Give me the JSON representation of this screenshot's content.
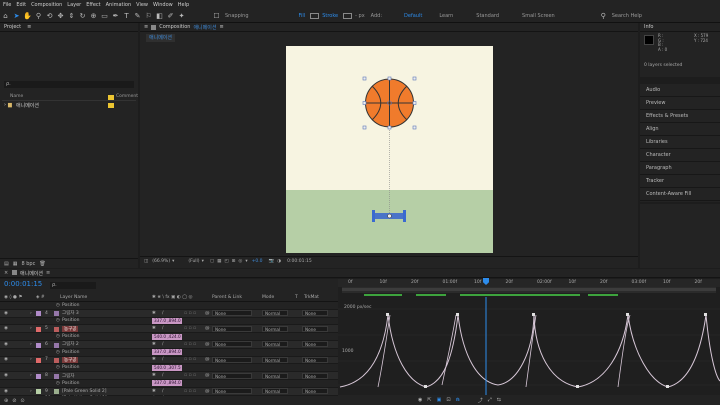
{
  "menu": [
    "File",
    "Edit",
    "Composition",
    "Layer",
    "Effect",
    "Animation",
    "View",
    "Window",
    "Help"
  ],
  "toolbar": {
    "snapping": "Snapping",
    "fill": "Fill",
    "stroke": "Stroke",
    "px": "- px",
    "add": "Add:",
    "workspaces": [
      "Default",
      "Learn",
      "Standard",
      "Small Screen"
    ],
    "search": "Search Help",
    "accent": "#2d8ceb"
  },
  "project": {
    "title": "Project",
    "search_placeholder": "ρ.",
    "col_name": "Name",
    "col_comment": "Comment",
    "item": "애니메이션"
  },
  "project_footer": {
    "bpc": "8 bpc"
  },
  "composition": {
    "header": "Composition",
    "comp_name": "애니메이션",
    "tab": "애니메이션",
    "footer": {
      "zoom": "(66.9%)",
      "res": "(Full)",
      "time": "0:00:01:15",
      "exposure": "+0.0"
    },
    "bg_top": "#f7f4e1",
    "bg_bottom": "#b6cfa6"
  },
  "info": {
    "title": "Info",
    "r": "R :",
    "g": "G :",
    "b": "B :",
    "a": "A : 0",
    "x": "X : 579",
    "y": "Y : 724",
    "selected": "0 layers selected"
  },
  "right_panels": [
    "Audio",
    "Preview",
    "Effects & Presets",
    "Align",
    "Libraries",
    "Character",
    "Paragraph",
    "Tracker",
    "Content-Aware Fill"
  ],
  "timeline": {
    "tab": "애니메이션",
    "timecode": "0:00:01:15",
    "search_placeholder": "ρ.",
    "headers": {
      "layer_name": "Layer Name",
      "parent": "Parent & Link",
      "mode": "Mode",
      "t": "T",
      "trkmat": "TrkMat"
    },
    "rows": [
      {
        "type": "prop",
        "name": "Position",
        "val": ""
      },
      {
        "type": "layer",
        "num": "4",
        "name": "그림자 3",
        "parent": "None",
        "mode": "Normal",
        "trk": "None",
        "color": "#b08bc9"
      },
      {
        "type": "prop",
        "name": "Position",
        "val": "337.0 ,894.0"
      },
      {
        "type": "layer",
        "num": "5",
        "name": "농구공",
        "parent": "None",
        "mode": "Normal",
        "trk": "None",
        "color": "#e06a6a"
      },
      {
        "type": "prop",
        "name": "Position",
        "val": "540.0 ,424.0"
      },
      {
        "type": "layer",
        "num": "6",
        "name": "그림자 2",
        "parent": "None",
        "mode": "Normal",
        "trk": "None",
        "color": "#b08bc9"
      },
      {
        "type": "prop",
        "name": "Position",
        "val": "337.0 ,894.0"
      },
      {
        "type": "layer",
        "num": "7",
        "name": "농구공",
        "parent": "None",
        "mode": "Normal",
        "trk": "None",
        "color": "#e06a6a"
      },
      {
        "type": "prop",
        "name": "Position",
        "val": "540.0 ,307.5"
      },
      {
        "type": "layer",
        "num": "8",
        "name": "그림자",
        "parent": "None",
        "mode": "Normal",
        "trk": "None",
        "color": "#b08bc9"
      },
      {
        "type": "prop",
        "name": "Position",
        "val": "337.0 ,894.0"
      },
      {
        "type": "layer",
        "num": "9",
        "name": "[Pale Green Solid 2]",
        "parent": "None",
        "mode": "Normal",
        "trk": "None",
        "color": "#b6cfa6"
      },
      {
        "type": "layer",
        "num": "10",
        "name": "[Pale Yellow Solid 1]",
        "parent": "None",
        "mode": "Normal",
        "trk": "None",
        "color": "#f0e9b0"
      }
    ],
    "ruler": [
      "0f",
      "10f",
      "20f",
      "01:00f",
      "10f",
      "20f",
      "02:00f",
      "10f",
      "20f",
      "03:00f",
      "10f",
      "20f"
    ],
    "graph_labels": [
      "2000 px/sec",
      "1000"
    ]
  }
}
